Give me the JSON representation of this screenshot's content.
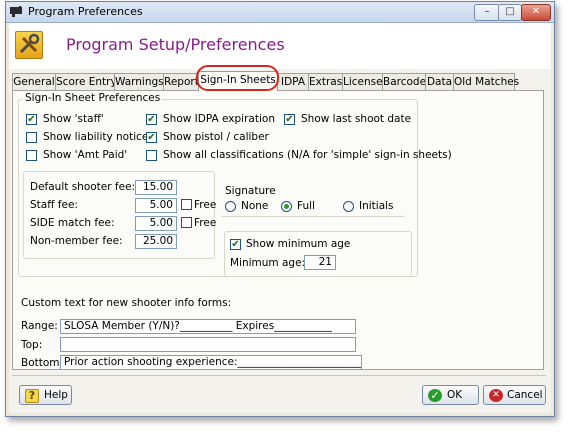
{
  "window": {
    "title": "Program Preferences",
    "controls": {
      "minimize": "–",
      "maximize": "□",
      "close": "✕"
    }
  },
  "header": {
    "title": "Program Setup/Preferences",
    "icon": "tools-icon"
  },
  "tabs": [
    {
      "label": "General"
    },
    {
      "label": "Score Entry"
    },
    {
      "label": "Warnings"
    },
    {
      "label": "Reports"
    },
    {
      "label": "Sign-In Sheets",
      "active": true
    },
    {
      "label": "IDPA"
    },
    {
      "label": "Extras"
    },
    {
      "label": "License"
    },
    {
      "label": "Barcode"
    },
    {
      "label": "Data"
    },
    {
      "label": "Old Matches"
    }
  ],
  "signin": {
    "group_title": "Sign-In Sheet Preferences",
    "checkboxes": [
      {
        "label": "Show 'staff'",
        "checked": true
      },
      {
        "label": "Show liability notice",
        "checked": false
      },
      {
        "label": "Show 'Amt Paid'",
        "checked": false
      },
      {
        "label": "Show IDPA expiration",
        "checked": true
      },
      {
        "label": "Show pistol / caliber",
        "checked": true
      },
      {
        "label": "Show all classifications (N/A for 'simple' sign-in sheets)",
        "checked": false
      },
      {
        "label": "Show last shoot date",
        "checked": true
      }
    ],
    "fees": {
      "default_label": "Default shooter fee:",
      "default_value": "15.00",
      "staff_label": "Staff fee:",
      "staff_value": "5.00",
      "side_label": "SIDE match fee:",
      "side_value": "5.00",
      "nonmember_label": "Non-member fee:",
      "nonmember_value": "25.00",
      "free_label": "Free",
      "staff_free": false,
      "side_free": false
    },
    "signature": {
      "label": "Signature",
      "options": [
        "None",
        "Full",
        "Initials"
      ],
      "selected": "Full"
    },
    "min_age": {
      "checkbox_label": "Show minimum age",
      "checked": true,
      "label": "Minimum age:",
      "value": "21"
    }
  },
  "custom": {
    "title": "Custom text for new shooter info forms:",
    "range_label": "Range:",
    "range_value": "SLOSA Member (Y/N)?__________  Expires___________",
    "top_label": "Top:",
    "top_value": "",
    "bottom_label": "Bottom:",
    "bottom_value": "Prior action shooting experience:_________________________"
  },
  "buttons": {
    "help": "Help",
    "ok": "OK",
    "cancel": "Cancel"
  },
  "colors": {
    "header_title": "#8b1a8f",
    "highlight_oval": "#d9261c",
    "ok_icon": "#2a9a2a",
    "cancel_icon": "#c62828"
  }
}
